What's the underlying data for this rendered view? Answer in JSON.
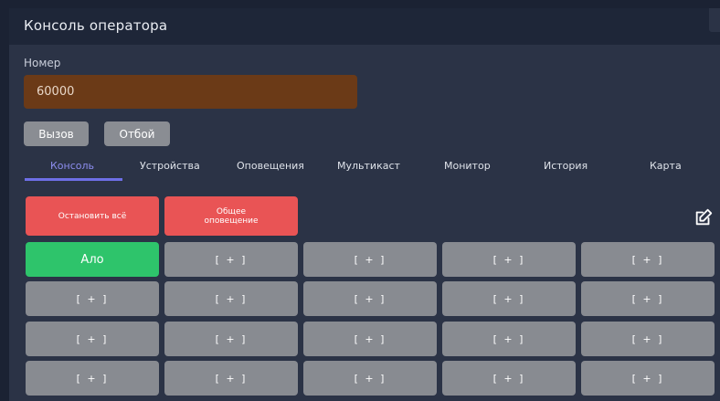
{
  "app": {
    "title": "Консоль оператора"
  },
  "number": {
    "label": "Номер",
    "value": "60000"
  },
  "actions": {
    "call_label": "Вызов",
    "hangup_label": "Отбой"
  },
  "tabs": [
    {
      "label": "Консоль",
      "active": true
    },
    {
      "label": "Устройства",
      "active": false
    },
    {
      "label": "Оповещения",
      "active": false
    },
    {
      "label": "Мультикаст",
      "active": false
    },
    {
      "label": "Монитор",
      "active": false
    },
    {
      "label": "История",
      "active": false
    },
    {
      "label": "Карта",
      "active": false
    }
  ],
  "console": {
    "stop_all_label": "Остановить всё",
    "general_alert_label": "Общее оповещение",
    "alo_label": "Ало",
    "slot_label": "[ + ]",
    "edit_icon": "edit-icon"
  },
  "colors": {
    "background": "#2b3346",
    "titlebar": "#1e2638",
    "input": "#6b3a17",
    "accent": "#6d6fe6",
    "danger": "#e95455",
    "success": "#2ec46b",
    "slot": "#888b91"
  }
}
